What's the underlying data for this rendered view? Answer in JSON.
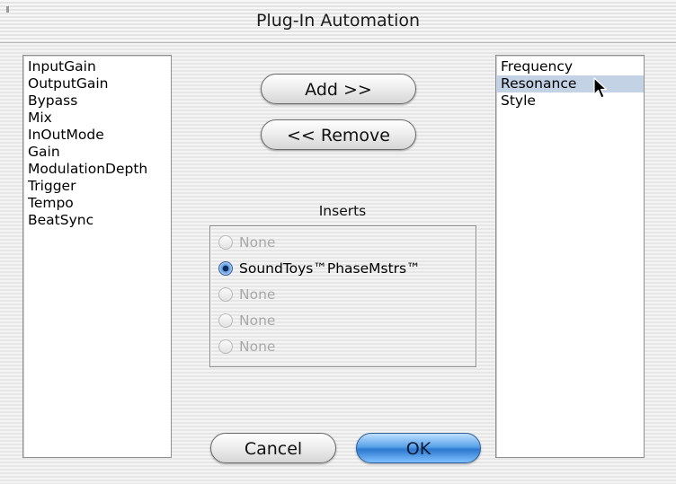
{
  "window": {
    "title": "Plug-In Automation"
  },
  "left_list": {
    "items": [
      "InputGain",
      "OutputGain",
      "Bypass",
      "Mix",
      "InOutMode",
      "Gain",
      "ModulationDepth",
      "Trigger",
      "Tempo",
      "BeatSync"
    ]
  },
  "right_list": {
    "items": [
      "Frequency",
      "Resonance",
      "Style"
    ],
    "selected": "Resonance"
  },
  "buttons": {
    "add": "Add >>",
    "remove": "<< Remove",
    "cancel": "Cancel",
    "ok": "OK"
  },
  "inserts": {
    "label": "Inserts",
    "options": [
      {
        "label": "None",
        "enabled": false,
        "selected": false
      },
      {
        "label": "SoundToys™PhaseMstrs™",
        "enabled": true,
        "selected": true
      },
      {
        "label": "None",
        "enabled": false,
        "selected": false
      },
      {
        "label": "None",
        "enabled": false,
        "selected": false
      },
      {
        "label": "None",
        "enabled": false,
        "selected": false
      }
    ]
  },
  "colors": {
    "selection": "#c4d2e6",
    "default_button": "#5aa3ea",
    "disabled_text": "#a9a9a9"
  },
  "icons": {
    "cursor": "arrow-cursor-icon"
  }
}
